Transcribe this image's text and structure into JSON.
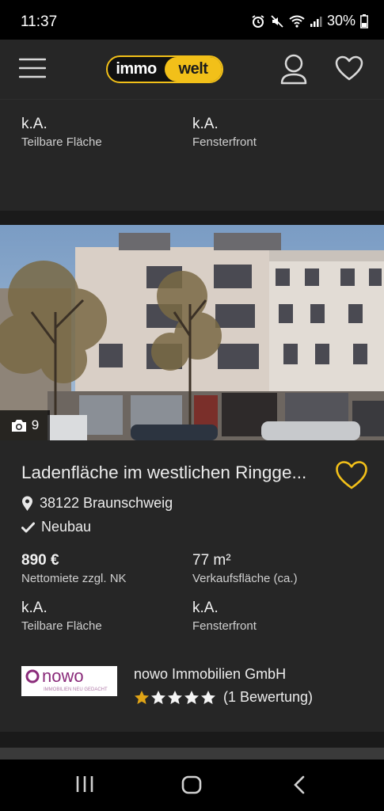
{
  "status_bar": {
    "time": "11:37",
    "battery": "30%"
  },
  "header": {
    "logo_left": "immo",
    "logo_right": "welt"
  },
  "colors": {
    "accent": "#f2c019",
    "background": "#262626",
    "company_logo": "#8a2b7a"
  },
  "previous_listing": {
    "attributes": [
      {
        "value": "k.A.",
        "label": "Teilbare Fläche"
      },
      {
        "value": "k.A.",
        "label": "Fensterfront"
      }
    ]
  },
  "listing": {
    "photo_count": "9",
    "title": "Ladenfläche im westlichen Ringge...",
    "location": "38122 Braunschweig",
    "tag": "Neubau",
    "price": {
      "value": "890 €",
      "label": "Nettomiete zzgl. NK"
    },
    "area": {
      "value": "77 m²",
      "label": "Verkaufsfläche (ca.)"
    },
    "divisible": {
      "value": "k.A.",
      "label": "Teilbare Fläche"
    },
    "window_front": {
      "value": "k.A.",
      "label": "Fensterfront"
    },
    "company": {
      "logo_text": "nowo",
      "logo_tagline": "IMMOBILIEN NEU GEDACHT",
      "name": "nowo Immobilien GmbH",
      "rating_stars": 1,
      "rating_max": 5,
      "rating_text": "(1 Bewertung)"
    }
  },
  "icons": {
    "menu": "hamburger-menu-icon",
    "user": "user-icon",
    "favorites": "heart-icon",
    "camera": "camera-icon",
    "location": "map-pin-icon",
    "check": "check-icon",
    "star": "star-icon"
  }
}
